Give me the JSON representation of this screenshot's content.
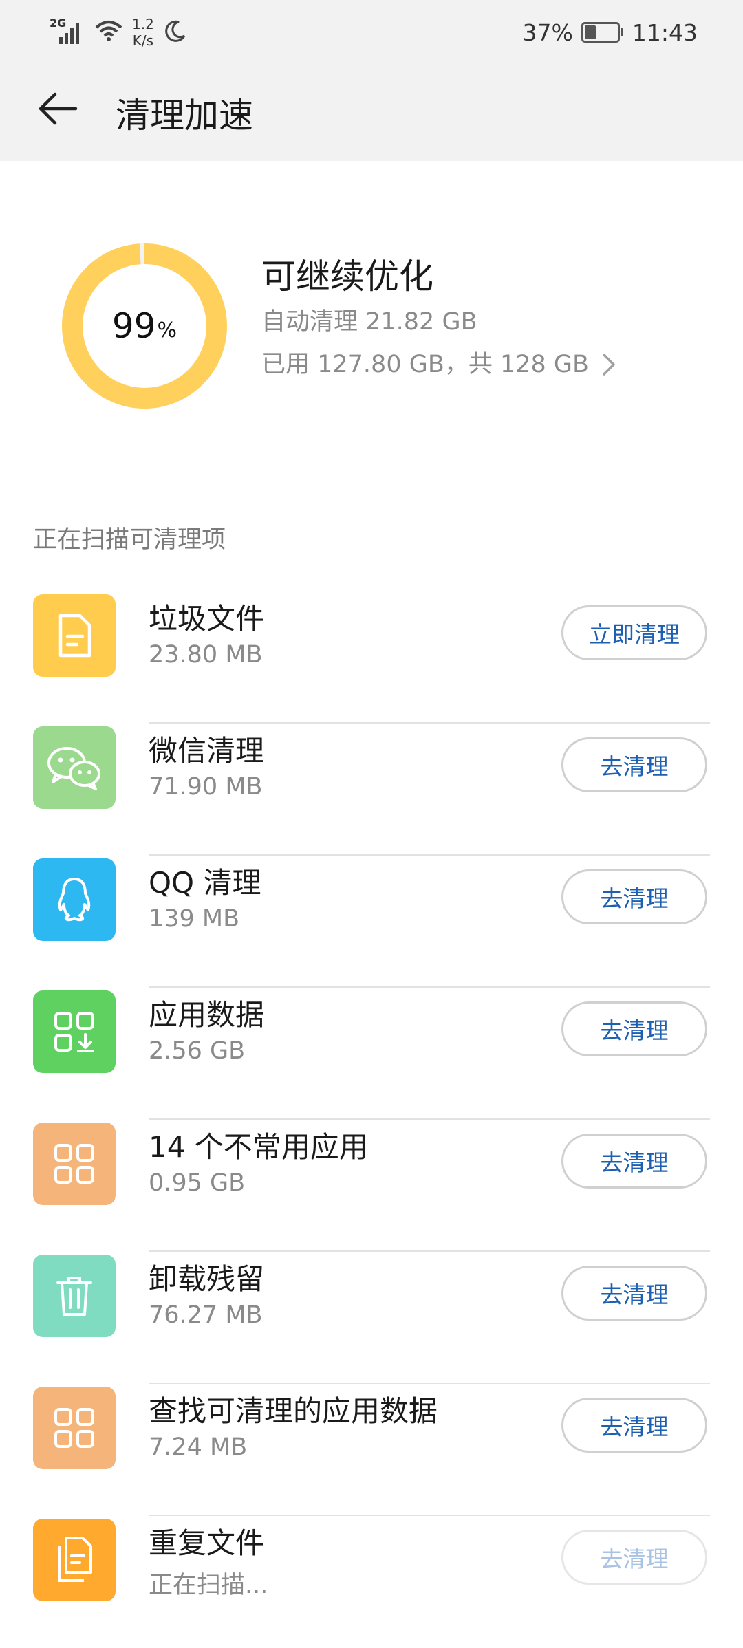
{
  "status_bar": {
    "signal_label": "2G",
    "net_speed_value": "1.2",
    "net_speed_unit": "K/s",
    "battery_percent": "37%",
    "battery_level": 0.37,
    "time": "11:43"
  },
  "app_bar": {
    "title": "清理加速"
  },
  "summary": {
    "progress_value": "99",
    "progress_unit": "%",
    "progress_fraction": 0.99,
    "ring_color": "#ffd15c",
    "ring_track_color": "#f3f3f3",
    "title": "可继续优化",
    "auto_clean": "自动清理 21.82 GB",
    "storage_used": "已用 127.80 GB，共 128 GB"
  },
  "section_label": "正在扫描可清理项",
  "items": [
    {
      "title": "垃圾文件",
      "size": "23.80 MB",
      "button": "立即清理",
      "icon": "document-icon",
      "color": "#ffcc4d",
      "enabled": true
    },
    {
      "title": "微信清理",
      "size": "71.90 MB",
      "button": "去清理",
      "icon": "wechat-icon",
      "color": "#9ad98e",
      "enabled": true
    },
    {
      "title": "QQ 清理",
      "size": "139 MB",
      "button": "去清理",
      "icon": "qq-penguin-icon",
      "color": "#2db8f2",
      "enabled": true
    },
    {
      "title": "应用数据",
      "size": "2.56 GB",
      "button": "去清理",
      "icon": "app-data-icon",
      "color": "#5fd161",
      "enabled": true
    },
    {
      "title": "14 个不常用应用",
      "size": "0.95 GB",
      "button": "去清理",
      "icon": "apps-grid-icon",
      "color": "#f5b57a",
      "enabled": true
    },
    {
      "title": "卸载残留",
      "size": "76.27 MB",
      "button": "去清理",
      "icon": "trash-icon",
      "color": "#7fdcc0",
      "enabled": true
    },
    {
      "title": "查找可清理的应用数据",
      "size": "7.24 MB",
      "button": "去清理",
      "icon": "apps-grid-icon",
      "color": "#f5b57a",
      "enabled": true
    },
    {
      "title": "重复文件",
      "size": "正在扫描...",
      "button": "去清理",
      "icon": "duplicate-files-icon",
      "color": "#ffa92e",
      "enabled": false
    }
  ]
}
